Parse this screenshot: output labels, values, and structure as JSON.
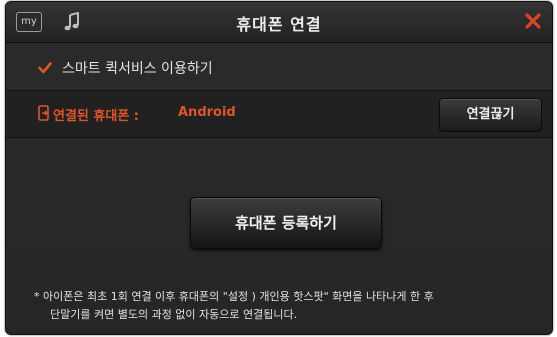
{
  "dialog": {
    "title": "휴대폰 연결",
    "my_badge": "my",
    "icons": {
      "music": "music-note-icon",
      "close": "close-x-icon",
      "phone": "phone-link-icon",
      "checkbox": "checkmark-icon"
    },
    "colors": {
      "accent": "#e0552b",
      "close": "#d9442b",
      "text": "#e3e3e3",
      "background": "#262626"
    }
  },
  "option": {
    "checked": true,
    "label": "스마트 퀵서비스 이용하기"
  },
  "connection": {
    "label": "연결된 휴대폰 :",
    "value": "Android",
    "disconnect_label": "연결끊기"
  },
  "register": {
    "label": "휴대폰 등록하기"
  },
  "note": {
    "line1": "* 아이폰은 최초 1회 연결 이후 휴대폰의 \"설정 ) 개인용 핫스팟\" 화면을 나타나게 한 후",
    "line2": "단말기를 켜면 별도의 과정 없이 자동으로 연결됩니다."
  }
}
